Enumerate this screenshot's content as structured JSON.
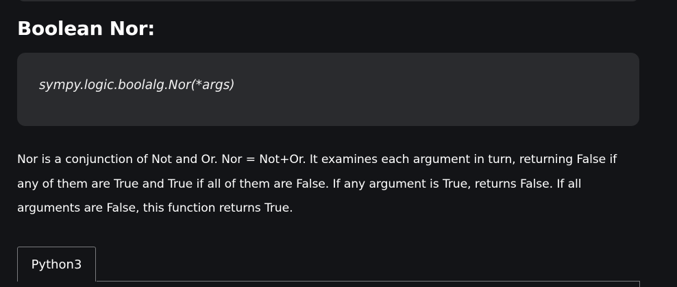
{
  "heading": "Boolean Nor:",
  "signature": "sympy.logic.boolalg.Nor(*args)",
  "description": "Nor is a conjunction of Not and Or. Nor = Not+Or. It examines each argument in turn, returning False if any of them are True and True if all of them are False. If any argument is True, returns False. If all arguments are False, this function returns True.",
  "tabs": [
    {
      "label": "Python3"
    }
  ]
}
